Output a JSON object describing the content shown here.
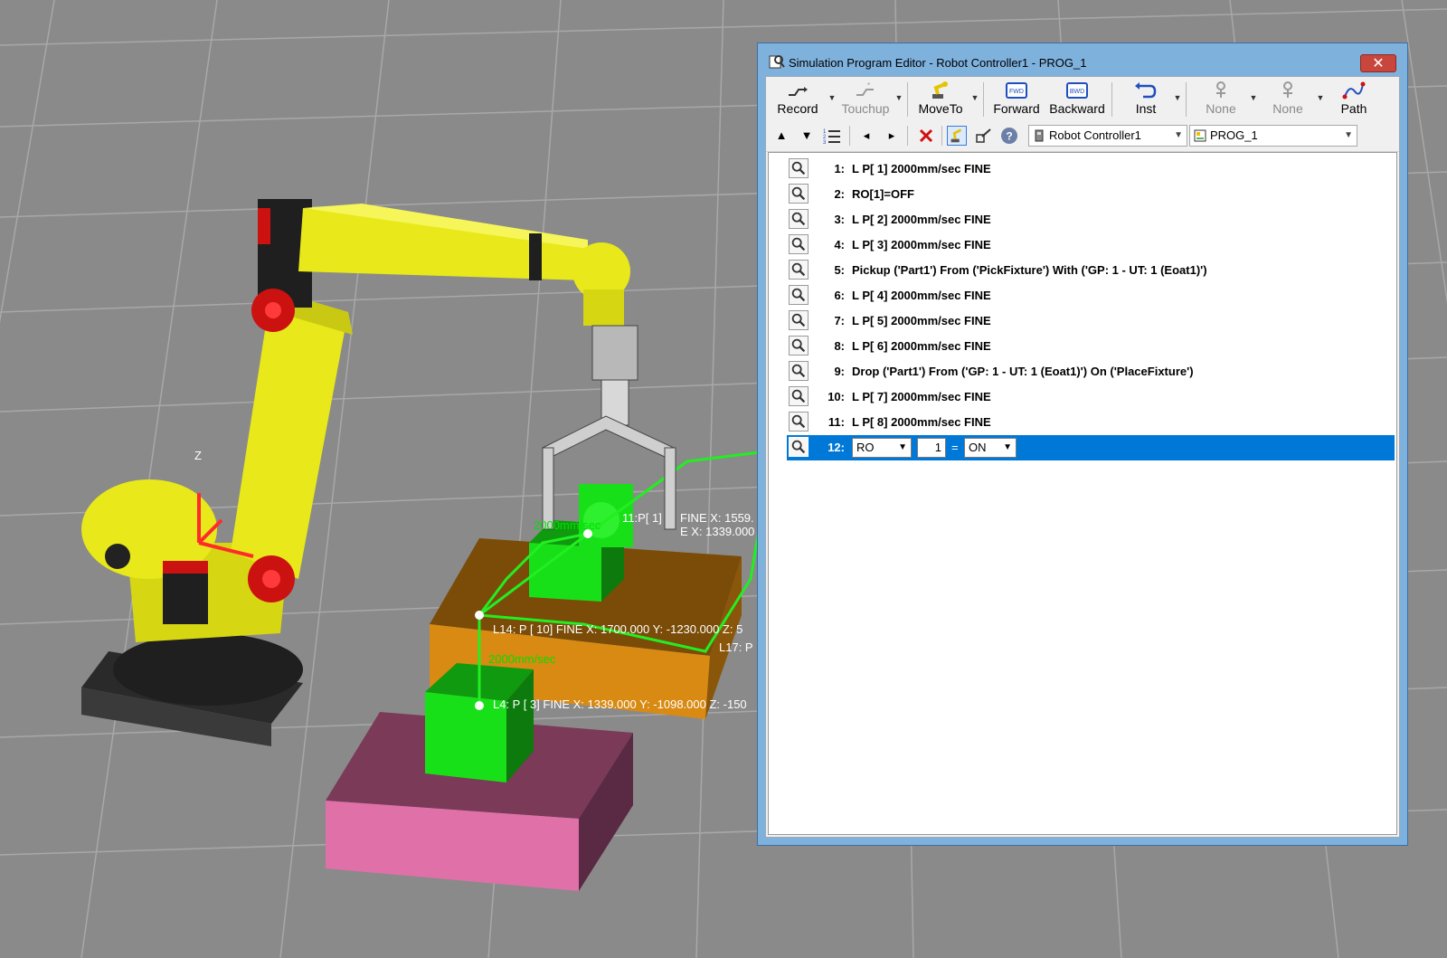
{
  "window": {
    "title": "Simulation Program Editor - Robot Controller1 - PROG_1",
    "close_glyph": "✕"
  },
  "toolbar": {
    "buttons": [
      {
        "label": "Record",
        "icon": "record-icon",
        "enabled": true
      },
      {
        "label": "Touchup",
        "icon": "touchup-icon",
        "enabled": false
      },
      {
        "label": "MoveTo",
        "icon": "robot-moveto-icon",
        "enabled": true
      },
      {
        "label": "Forward",
        "icon": "forward-icon",
        "enabled": true
      },
      {
        "label": "Backward",
        "icon": "backward-icon",
        "enabled": true
      },
      {
        "label": "Inst",
        "icon": "instruction-icon",
        "enabled": true
      },
      {
        "label": "None",
        "icon": "none-icon",
        "enabled": false
      },
      {
        "label": "None",
        "icon": "none-icon",
        "enabled": false
      },
      {
        "label": "Path",
        "icon": "path-icon",
        "enabled": true
      }
    ],
    "icon_forward_text": "FWD",
    "icon_backward_text": "BWD"
  },
  "toolbar2": {
    "controller_combo": "Robot Controller1",
    "program_combo": "PROG_1"
  },
  "program": {
    "lines": [
      {
        "num": "1:",
        "text": "L P[ 1] 2000mm/sec FINE"
      },
      {
        "num": "2:",
        "text": "RO[1]=OFF"
      },
      {
        "num": "3:",
        "text": "L P[ 2] 2000mm/sec FINE"
      },
      {
        "num": "4:",
        "text": "L P[ 3] 2000mm/sec FINE"
      },
      {
        "num": "5:",
        "text": "Pickup ('Part1') From ('PickFixture') With ('GP: 1 - UT: 1  (Eoat1)')"
      },
      {
        "num": "6:",
        "text": "L P[ 4] 2000mm/sec FINE"
      },
      {
        "num": "7:",
        "text": "L P[ 5] 2000mm/sec FINE"
      },
      {
        "num": "8:",
        "text": "L P[ 6] 2000mm/sec FINE"
      },
      {
        "num": "9:",
        "text": "Drop ('Part1') From ('GP: 1 - UT: 1  (Eoat1)') On ('PlaceFixture')"
      },
      {
        "num": "10:",
        "text": "L P[ 7] 2000mm/sec FINE"
      },
      {
        "num": "11:",
        "text": "L P[ 8] 2000mm/sec FINE"
      }
    ],
    "selected_line": {
      "num": "12:",
      "register_type": "RO",
      "register_index": "1",
      "equals": "=",
      "value": "ON"
    }
  },
  "scene": {
    "labels": {
      "z_axis": "Z",
      "p11": "11:P[ 1]",
      "fine": "FINE X: 1559.",
      "x_readout": "E X: 1339.000",
      "p4": "L4: P [  3]    FINE X: 1339.000 Y: -1098.000 Z: -150",
      "p14": "L14: P [  10]     FINE X: 1700.000 Y: -1230.000 Z: 5",
      "p17": "L17: P",
      "speed1": "2000mm/sec",
      "speed2": "2000mm/sec"
    },
    "colors": {
      "floor": "#8a8a8a",
      "robot": "#e8e81a",
      "part": "#18e018",
      "pick_fixture": "#d98a12",
      "place_fixture": "#e070a8",
      "selection": "#0078d7"
    }
  }
}
